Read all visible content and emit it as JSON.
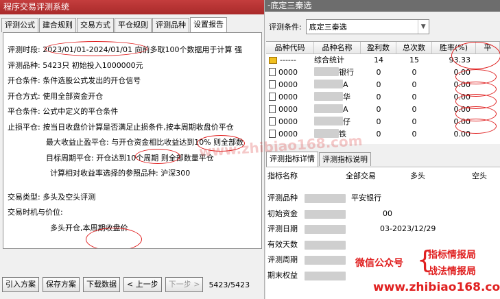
{
  "left_window": {
    "title": "程序交易评测系统",
    "tabs": [
      "评测公式",
      "建合规则",
      "交易方式",
      "平仓规则",
      "评测品种",
      "设置报告"
    ],
    "report": {
      "period_label": "评测时段:",
      "period_dates": "2023/01/01-2024/01/01",
      "period_rest": " 向前多取100个数据用于计算 强",
      "variety_line": "评测品种:  5423只 初始投入1000000元",
      "open_cond": "开仓条件:  条件选股公式发出的开仓信号",
      "open_way": "开仓方式:  使用全部资金开仓",
      "close_cond": "平仓条件:  公式中定义的平仓条件",
      "stoploss": "止损平仓:  按当日收盘价计算是否满足止损条件,按本周期收盘价平仓",
      "max_profit": "最大收益止盈平仓:  与开仓资金相比收益达到10% 则全部数",
      "target_cycle": "目标周期平仓:  开仓达到10个周期 则全部数量平仓",
      "relative": "计算相对收益率选择的参照品种:  沪深300",
      "trade_type": "交易类型:  多头及空头评测",
      "trade_timing": "交易时机与价位:",
      "long_open": "多头开仓,本周期收盘价"
    },
    "buttons": [
      "引入方案",
      "保存方案",
      "下载数据",
      "< 上一步",
      "下一步 >"
    ],
    "counter": "5423/5423"
  },
  "right_window": {
    "title": "-底定三秦选",
    "condition_label": "评测条件:",
    "condition_value": "底定三秦选",
    "table": {
      "headers": [
        "品种代码",
        "品种名称",
        "盈利数",
        "总次数",
        "胜率(%)",
        "平"
      ],
      "summary": {
        "code": "------",
        "name": "综合统计",
        "wins": "14",
        "total": "15",
        "rate": "93.33"
      },
      "rows": [
        {
          "code": "0000",
          "name_tail": "银行",
          "wins": "0",
          "total": "0",
          "rate": "0.00"
        },
        {
          "code": "0000",
          "name_tail": "A",
          "wins": "0",
          "total": "0",
          "rate": "0.00"
        },
        {
          "code": "0000",
          "name_tail": "华",
          "wins": "0",
          "total": "0",
          "rate": "0.00"
        },
        {
          "code": "0000",
          "name_tail": "A",
          "wins": "0",
          "total": "0",
          "rate": "0.00"
        },
        {
          "code": "0000",
          "name_tail": "仔",
          "wins": "0",
          "total": "0",
          "rate": "0.00"
        },
        {
          "code": "0000",
          "name_tail": "铁",
          "wins": "0",
          "total": "0",
          "rate": "0.00"
        }
      ]
    },
    "detail_tabs": [
      "评测指标详情",
      "评测指标说明"
    ],
    "detail_headers": [
      "指标名称",
      "全部交易",
      "多头",
      "空头"
    ],
    "detail_rows": [
      {
        "name": "评测品种",
        "value": "平安银行"
      },
      {
        "name": "初始资金",
        "value": "00"
      },
      {
        "name": "评测日期",
        "value": "03-2023/12/29"
      },
      {
        "name": "有效天数",
        "value": ""
      },
      {
        "name": "评测周期",
        "value": ""
      },
      {
        "name": "期末权益",
        "value": ""
      }
    ]
  },
  "watermark": {
    "center_url": "www.zhibiao168.com",
    "wechat_label": "微信公众号",
    "line1": "指标情报局",
    "line2": "战法情报局",
    "url": "www.zhibiao168.com"
  },
  "colors": {
    "annotation": "#e02020",
    "left_title_bg": "#b53232",
    "right_title_bg": "#6d6d6d"
  }
}
